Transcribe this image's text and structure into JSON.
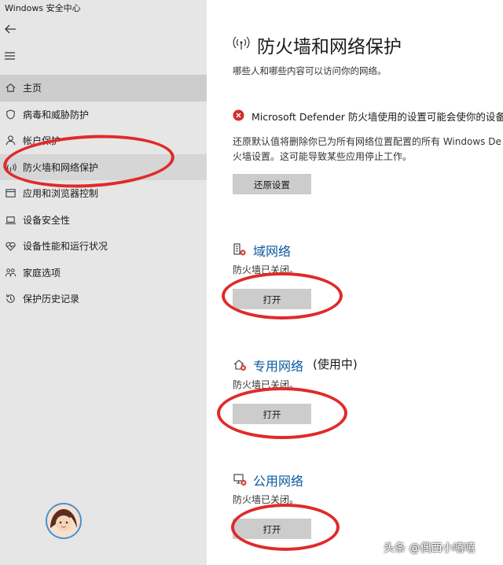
{
  "window": {
    "title": "Windows 安全中心"
  },
  "sidebar": {
    "items": [
      {
        "label": "主页",
        "icon": "home-icon"
      },
      {
        "label": "病毒和威胁防护",
        "icon": "shield-icon"
      },
      {
        "label": "帐户保护",
        "icon": "person-icon"
      },
      {
        "label": "防火墙和网络保护",
        "icon": "wifi-signal-icon"
      },
      {
        "label": "应用和浏览器控制",
        "icon": "app-window-icon"
      },
      {
        "label": "设备安全性",
        "icon": "laptop-icon"
      },
      {
        "label": "设备性能和运行状况",
        "icon": "heart-pulse-icon"
      },
      {
        "label": "家庭选项",
        "icon": "family-icon"
      },
      {
        "label": "保护历史记录",
        "icon": "history-icon"
      }
    ]
  },
  "main": {
    "title": "防火墙和网络保护",
    "subtitle": "哪些人和哪些内容可以访问你的网络。",
    "warning": "Microsoft Defender 防火墙使用的设置可能会使你的设备不",
    "restore_desc_line1": "还原默认值将删除你已为所有网络位置配置的所有 Windows De",
    "restore_desc_line2": "火墙设置。这可能导致某些应用停止工作。",
    "restore_button": "还原设置",
    "networks": [
      {
        "name": "域网络",
        "in_use": "",
        "status": "防火墙已关闭。",
        "button": "打开"
      },
      {
        "name": "专用网络",
        "in_use": "(使用中)",
        "status": "防火墙已关闭。",
        "button": "打开"
      },
      {
        "name": "公用网络",
        "in_use": "",
        "status": "防火墙已关闭。",
        "button": "打开"
      }
    ]
  },
  "watermark": "头条 @偶西小嘻嘻",
  "colors": {
    "accent": "#0a5aa0",
    "annotation": "#e02a2a",
    "warning": "#d32f2f"
  }
}
